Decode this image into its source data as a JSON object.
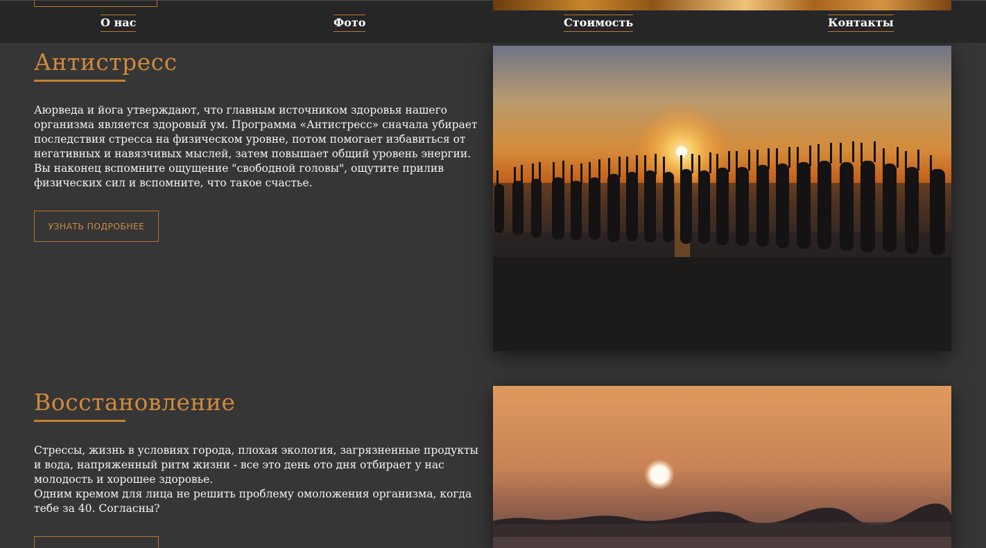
{
  "nav": {
    "items": [
      {
        "label": "О нас"
      },
      {
        "label": "Фото"
      },
      {
        "label": "Стоимость"
      },
      {
        "label": "Контакты"
      }
    ]
  },
  "sections": [
    {
      "title": "Антистресс",
      "paragraphs": [
        "Аюрведа и йога утверждают, что главным источником здоровья нашего организма является здоровый ум. Программа «Антистресс» сначала убирает последствия стресса на физическом уровне, потом помогает избавиться от негативных и навязчивых мыслей, затем повышает общий уровень энергии. Вы наконец вспомните ощущение \"свободной головы\", ощутите прилив физических сил и вспомните, что такое счастье."
      ],
      "button_label": "УЗНАТЬ ПОДРОБНЕЕ"
    },
    {
      "title": "Восстановление",
      "paragraphs": [
        "Стрессы, жизнь в условиях города, плохая экология, загрязненные продукты и вода, напряженный ритм жизни - все это день ото дня отбирает у нас молодость и хорошее здоровье.",
        "Одним кремом для лица не решить проблему омоложения организма, когда тебе за 40. Согласны?"
      ]
    }
  ],
  "colors": {
    "accent": "#c8802e",
    "background": "#363636",
    "nav_background": "#262626"
  }
}
